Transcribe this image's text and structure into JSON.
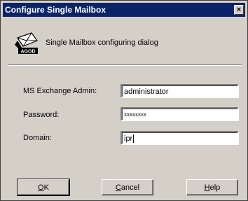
{
  "window": {
    "title": "Configure Single Mailbox",
    "close_glyph": "×"
  },
  "header": {
    "icon": "mailbox-config-icon",
    "icon_label": "AGOD",
    "text": "Single Mailbox configuring dialog"
  },
  "form": {
    "admin_label": "MS Exchange Admin:",
    "admin_value": "administrator",
    "password_label": "Password:",
    "password_value": "xxxxxxxx",
    "domain_label": "Domain:",
    "domain_value": "ipr"
  },
  "buttons": {
    "ok_label_accel": "O",
    "ok_label_rest": "K",
    "cancel_label_accel": "C",
    "cancel_label_rest": "ancel",
    "help_label_accel": "H",
    "help_label_rest": "elp"
  }
}
